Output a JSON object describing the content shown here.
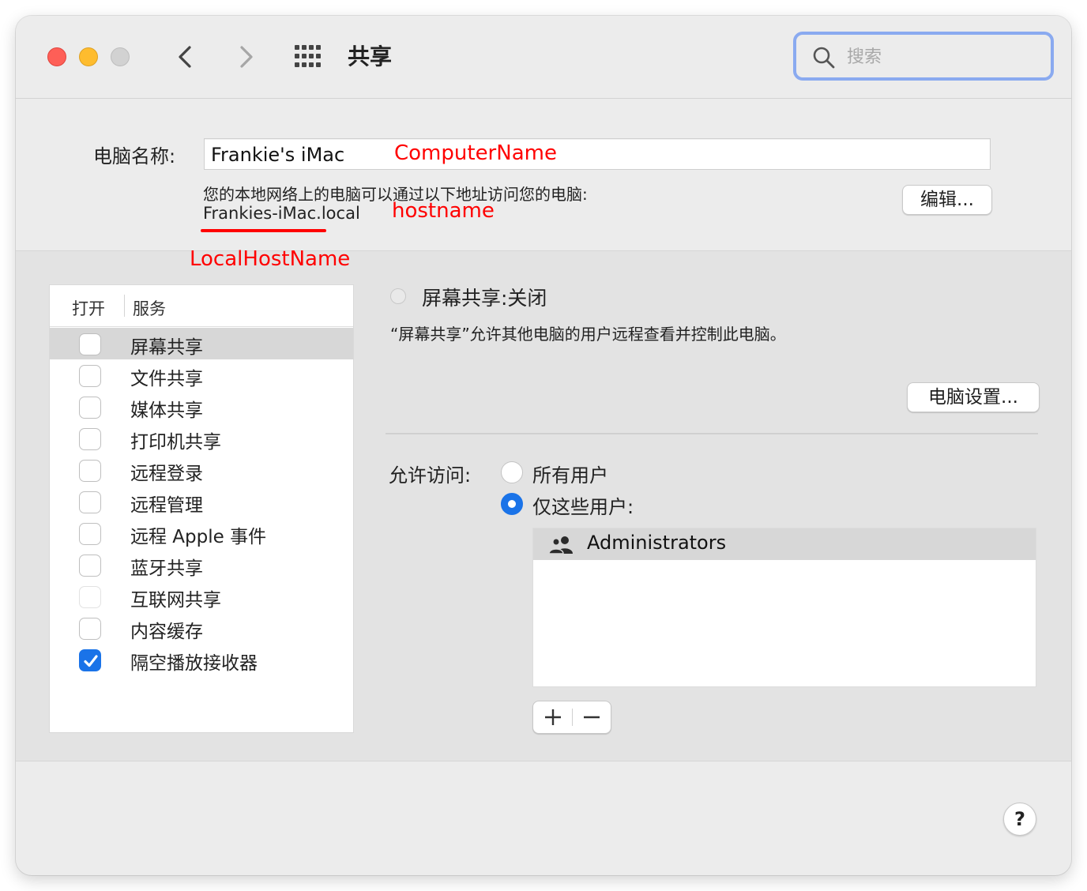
{
  "window": {
    "title": "共享"
  },
  "search": {
    "placeholder": "搜索"
  },
  "computer_name": {
    "label": "电脑名称:",
    "value": "Frankie's iMac",
    "annotation": "ComputerName"
  },
  "local_address": {
    "hint": "您的本地网络上的电脑可以通过以下地址访问您的电脑:",
    "address": "Frankies-iMac.local",
    "hostname_annotation": "hostname",
    "localhostname_annotation": "LocalHostName"
  },
  "edit_button": {
    "label": "编辑..."
  },
  "services": {
    "header_on": "打开",
    "header_service": "服务",
    "items": [
      {
        "label": "屏幕共享",
        "checked": false,
        "selected": true
      },
      {
        "label": "文件共享",
        "checked": false
      },
      {
        "label": "媒体共享",
        "checked": false
      },
      {
        "label": "打印机共享",
        "checked": false
      },
      {
        "label": "远程登录",
        "checked": false
      },
      {
        "label": "远程管理",
        "checked": false
      },
      {
        "label": "远程 Apple 事件",
        "checked": false
      },
      {
        "label": "蓝牙共享",
        "checked": false
      },
      {
        "label": "互联网共享",
        "checked": false
      },
      {
        "label": "内容缓存",
        "checked": false
      },
      {
        "label": "隔空播放接收器",
        "checked": true
      }
    ]
  },
  "detail": {
    "status": "屏幕共享:关闭",
    "description": "“屏幕共享”允许其他电脑的用户远程查看并控制此电脑。",
    "settings_button": "电脑设置...",
    "allow_label": "允许访问:",
    "option_all": "所有用户",
    "option_only": "仅这些用户:",
    "selected_option": "仅这些用户:",
    "users": [
      "Administrators"
    ],
    "add_label": "+",
    "remove_label": "−"
  },
  "help": {
    "label": "?"
  },
  "colors": {
    "accent": "#1a73e8",
    "annotation": "#ff0000",
    "search_focus": "#8aaaf0"
  }
}
